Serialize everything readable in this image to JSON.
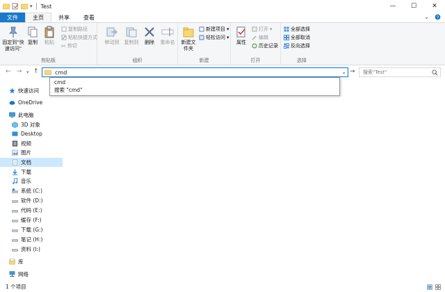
{
  "window": {
    "title": "Test",
    "minimize": "—",
    "maximize": "☐",
    "close": "✕"
  },
  "tabs": [
    {
      "label": "文件"
    },
    {
      "label": "主页"
    },
    {
      "label": "共享"
    },
    {
      "label": "查看"
    }
  ],
  "ribbon": {
    "clipboard": {
      "pin": "固定到\"快速访问\"",
      "copy": "复制",
      "paste": "粘贴",
      "copy_path": "复制路径",
      "paste_shortcut": "粘贴快捷方式",
      "cut": "剪切",
      "label": "剪贴板"
    },
    "organize": {
      "move_to": "移动到",
      "copy_to": "复制到",
      "delete": "删除",
      "rename": "重命名",
      "label": "组织"
    },
    "new": {
      "new_folder": "新建文件夹",
      "new_item": "新建项目",
      "easy_access": "轻松访问",
      "label": "新建"
    },
    "open": {
      "properties": "属性",
      "open": "打开",
      "edit": "编辑",
      "history": "历史记录",
      "label": "打开"
    },
    "select": {
      "select_all": "全部选择",
      "select_none": "全部取消",
      "invert": "反向选择",
      "label": "选择"
    }
  },
  "address": {
    "value": "cmd",
    "search_placeholder": "搜索\"Test\""
  },
  "autocomplete": [
    {
      "label": "cmd"
    },
    {
      "label": "搜索 \"cmd\""
    }
  ],
  "sidebar": {
    "items": [
      {
        "label": "快速访问",
        "icon": "star-icon"
      },
      {
        "label": "OneDrive",
        "icon": "cloud-icon"
      },
      {
        "label": "此电脑",
        "icon": "computer-icon"
      },
      {
        "label": "3D 对象",
        "icon": "cube-icon"
      },
      {
        "label": "Desktop",
        "icon": "desktop-icon"
      },
      {
        "label": "视频",
        "icon": "video-icon"
      },
      {
        "label": "图片",
        "icon": "picture-icon"
      },
      {
        "label": "文档",
        "icon": "document-icon"
      },
      {
        "label": "下载",
        "icon": "download-icon"
      },
      {
        "label": "音乐",
        "icon": "music-icon"
      },
      {
        "label": "系统 (C:)",
        "icon": "drive-icon"
      },
      {
        "label": "软件 (D:)",
        "icon": "drive-icon"
      },
      {
        "label": "代码 (E:)",
        "icon": "drive-icon"
      },
      {
        "label": "缓存 (F:)",
        "icon": "drive-icon"
      },
      {
        "label": "下载 (G:)",
        "icon": "drive-icon"
      },
      {
        "label": "笔记 (H:)",
        "icon": "drive-icon"
      },
      {
        "label": "资料 (I:)",
        "icon": "drive-icon"
      },
      {
        "label": "库",
        "icon": "library-icon"
      },
      {
        "label": "网络",
        "icon": "network-icon"
      }
    ]
  },
  "status": {
    "count": "1 个项目"
  },
  "colors": {
    "accent": "#1979ca",
    "selection": "#cce8ff",
    "folder": "#f8d775"
  }
}
